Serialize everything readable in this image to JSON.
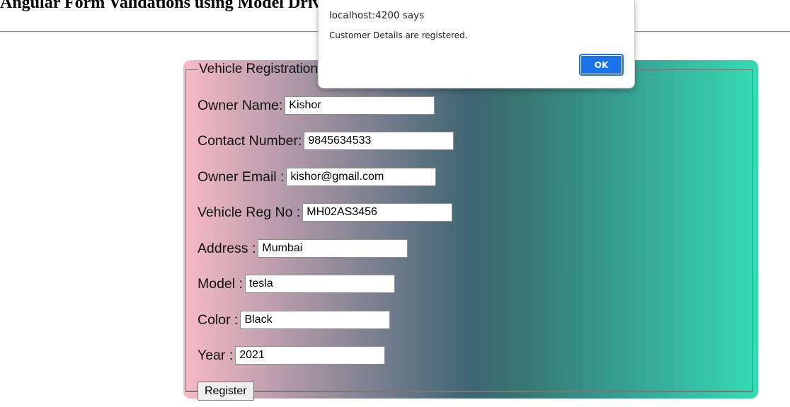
{
  "page": {
    "heading": "Angular Form Validations using Model Driven Forms"
  },
  "form": {
    "legend": "Vehicle Registration",
    "fields": [
      {
        "label": "Owner Name:",
        "value": "Kishor"
      },
      {
        "label": "Contact Number:",
        "value": "9845634533"
      },
      {
        "label": "Owner Email :",
        "value": "kishor@gmail.com"
      },
      {
        "label": "Vehicle Reg No :",
        "value": "MH02AS3456"
      },
      {
        "label": "Address :",
        "value": "Mumbai"
      },
      {
        "label": "Model :",
        "value": "tesla"
      },
      {
        "label": "Color :",
        "value": "Black"
      },
      {
        "label": "Year :",
        "value": "2021"
      }
    ],
    "submit_label": "Register"
  },
  "alert": {
    "origin": "localhost:4200 says",
    "message": "Customer Details are registered.",
    "ok_label": "OK",
    "ok_color": "#1a73e8"
  },
  "colors": {
    "gradient_start": "#f8bac6",
    "gradient_middle": "#3d6573",
    "gradient_end": "#35dcb3"
  }
}
